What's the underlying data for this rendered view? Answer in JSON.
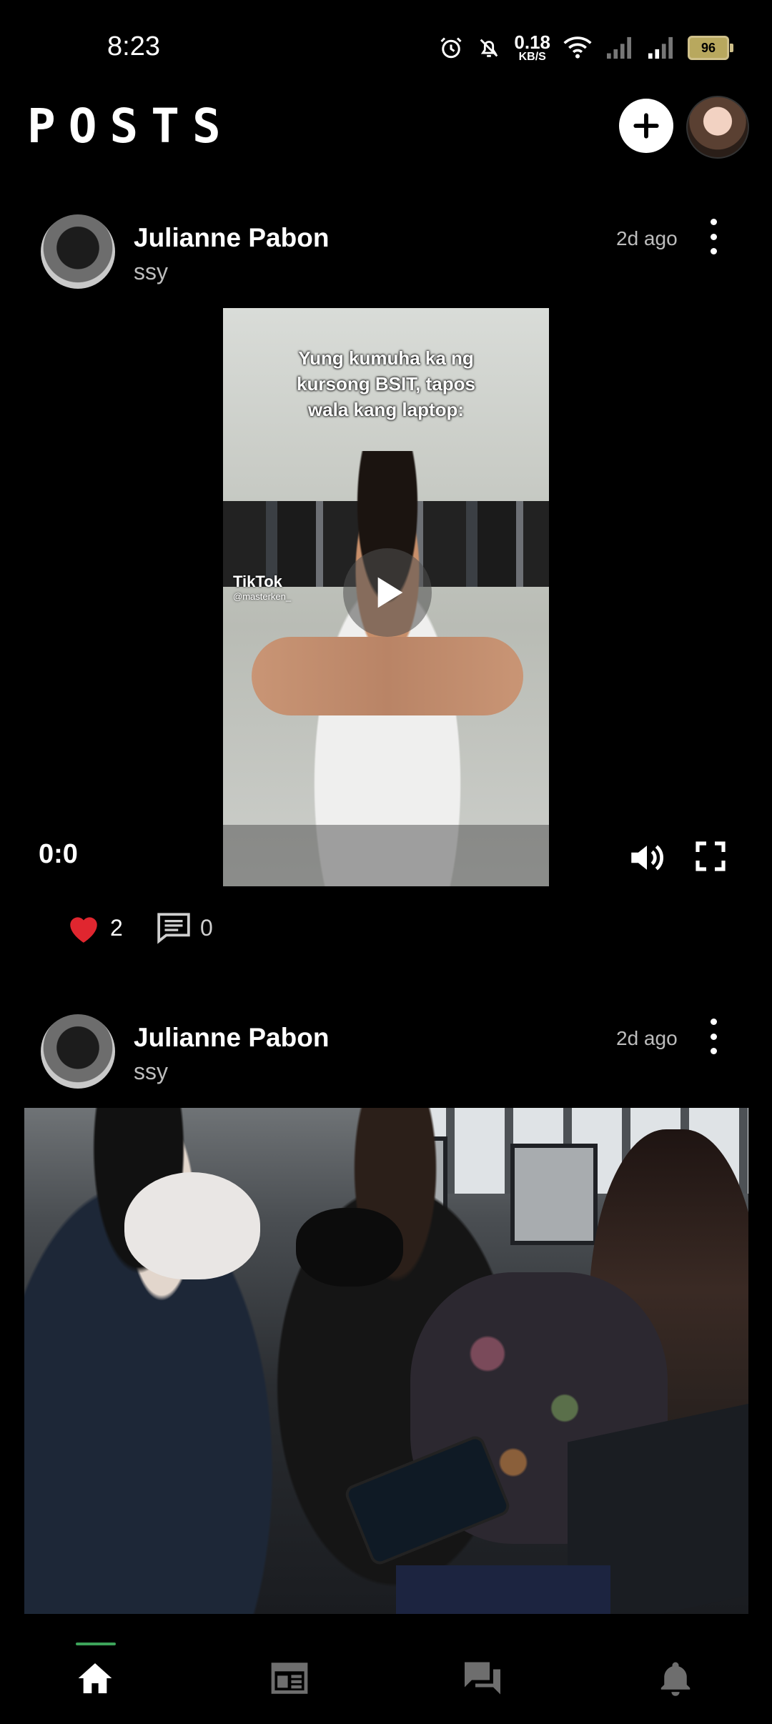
{
  "status_bar": {
    "time": "8:23",
    "net_speed_value": "0.18",
    "net_speed_unit": "KB/S",
    "battery": "96"
  },
  "header": {
    "title": "POSTS",
    "add_icon": "plus-icon",
    "profile_icon": "avatar"
  },
  "posts": [
    {
      "author": "Julianne Pabon",
      "subtitle": "ssy",
      "time": "2d ago",
      "media_type": "video",
      "video_caption": [
        "Yung kumuha ka ng",
        "kursong BSIT, tapos",
        "wala kang laptop:"
      ],
      "watermark": "TikTok",
      "watermark_handle": "@masterken_",
      "video_time": "0:0",
      "likes": "2",
      "comments": "0"
    },
    {
      "author": "Julianne Pabon",
      "subtitle": "ssy",
      "time": "2d ago",
      "media_type": "image"
    }
  ],
  "nav": {
    "items": [
      "home-icon",
      "feed-icon",
      "chat-icon",
      "bell-icon"
    ],
    "active": "home-icon",
    "active_color": "#3da35a"
  },
  "colors": {
    "background": "#000000",
    "like": "#e0262f",
    "secondary_text": "#bdbdbd"
  }
}
